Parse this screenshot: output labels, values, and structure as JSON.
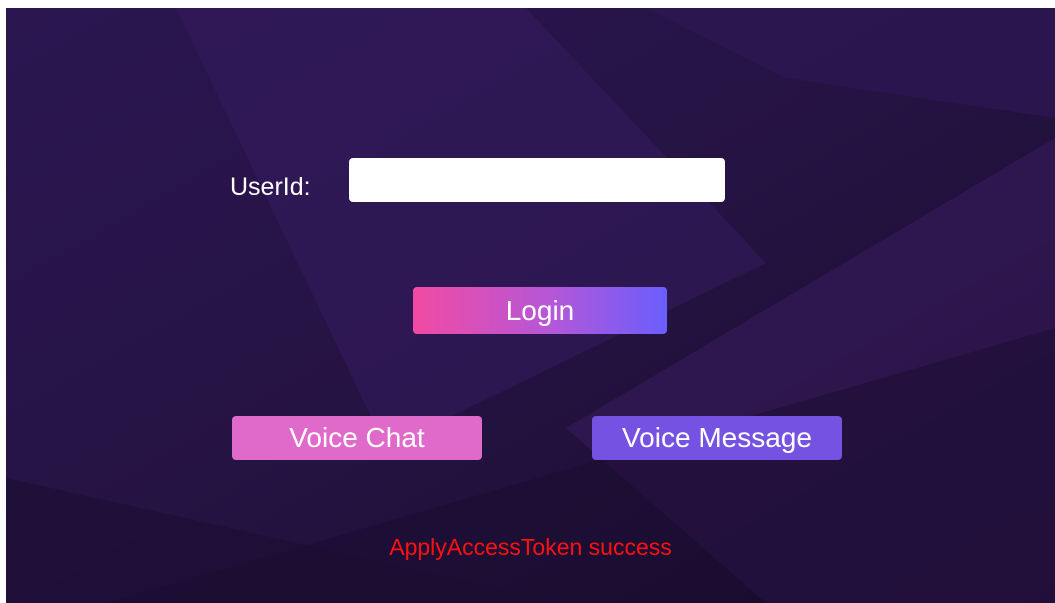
{
  "form": {
    "userid_label": "UserId:",
    "userid_value": ""
  },
  "buttons": {
    "login_label": "Login",
    "voice_chat_label": "Voice Chat",
    "voice_message_label": "Voice Message"
  },
  "status": {
    "message": "ApplyAccessToken success"
  },
  "colors": {
    "background": "#261446",
    "login_gradient_start": "#f24aa3",
    "login_gradient_end": "#6a5efc",
    "voice_chat": "#e06ac9",
    "voice_message": "#7552e2",
    "status_text": "#ff1010"
  }
}
